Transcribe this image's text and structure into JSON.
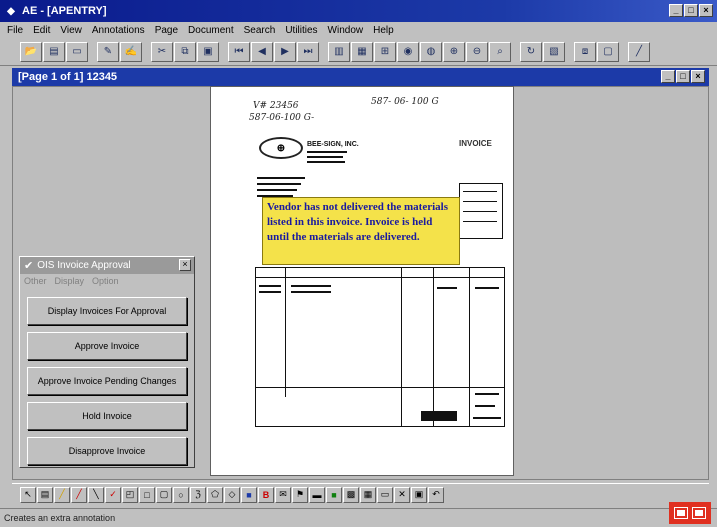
{
  "window": {
    "title": "AE - [APENTRY]"
  },
  "menu": [
    "File",
    "Edit",
    "View",
    "Annotations",
    "Page",
    "Document",
    "Search",
    "Utilities",
    "Window",
    "Help"
  ],
  "child_window": {
    "title": "[Page 1 of 1] 12345"
  },
  "document": {
    "handwriting_1": "V# 23456",
    "handwriting_2": "587-06-100 G-",
    "handwriting_3": "587- 06- 100 G",
    "company": "BEE-SIGN, INC.",
    "invoice_heading": "INVOICE",
    "annotation_note": "Vendor has not delivered the materials listed in this invoice. Invoice is held until the materials are delivered."
  },
  "approval_panel": {
    "title": "OIS Invoice Approval",
    "menu": [
      "Other",
      "Display",
      "Option"
    ],
    "buttons": [
      "Display Invoices For Approval",
      "Approve Invoice",
      "Approve Invoice Pending Changes",
      "Hold Invoice",
      "Disapprove Invoice"
    ]
  },
  "status": {
    "text": "Creates an extra annotation"
  },
  "colors": {
    "title_bar": "#1c3aa8",
    "note": "#f4e24a",
    "note_text": "#1a1aa0"
  }
}
